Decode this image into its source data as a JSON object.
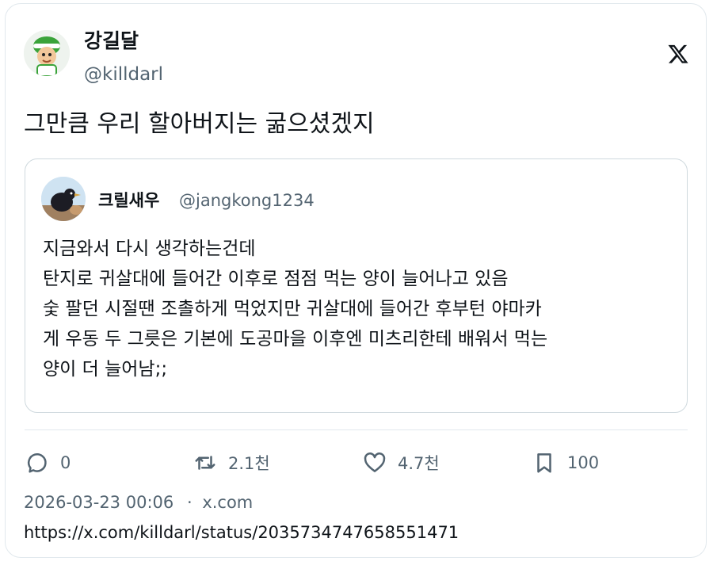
{
  "author": {
    "display_name": "강길달",
    "handle": "@killdarl"
  },
  "brand": {
    "icon": "x-logo-icon",
    "color": "#0f1419"
  },
  "tweet": {
    "text": "그만큼 우리 할아버지는 굶으셨겠지"
  },
  "quoted": {
    "display_name": "크릴새우",
    "handle": "@jangkong1234",
    "lines": [
      "지금와서 다시 생각하는건데",
      "탄지로 귀살대에 들어간 이후로 점점 먹는 양이 늘어나고 있음",
      "숯 팔던 시절땐 조촐하게 먹었지만 귀살대에 들어간 후부턴 야마카",
      "게 우동 두 그릇은 기본에 도공마을 이후엔 미츠리한테 배워서 먹는",
      "양이 더 늘어남;;"
    ]
  },
  "actions": {
    "reply": {
      "icon": "reply-icon",
      "count": "0"
    },
    "retweet": {
      "icon": "retweet-icon",
      "count": "2.1천"
    },
    "like": {
      "icon": "heart-icon",
      "count": "4.7천"
    },
    "bookmark": {
      "icon": "bookmark-icon",
      "count": "100"
    }
  },
  "meta": {
    "timestamp": "2026-03-23 00:06",
    "separator": "·",
    "source": "x.com",
    "url": "https://x.com/killdarl/status/2035734747658551471"
  },
  "colors": {
    "text_primary": "#0f1419",
    "text_secondary": "#536471",
    "border": "#cfd9de"
  }
}
